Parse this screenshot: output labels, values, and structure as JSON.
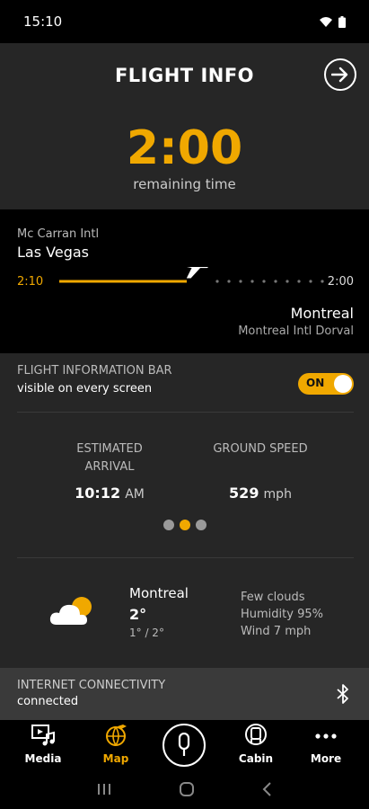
{
  "status_bar": {
    "time": "15:10"
  },
  "header": {
    "title": "FLIGHT INFO",
    "remaining_time": "2:00",
    "remaining_label": "remaining time"
  },
  "route": {
    "origin_airport": "Mc Carran Intl",
    "origin_city": "Las Vegas",
    "elapsed": "2:10",
    "remaining": "2:00",
    "progress": 0.5,
    "destination_city": "Montreal",
    "destination_airport": "Montreal Intl Dorval"
  },
  "info_bar": {
    "title": "FLIGHT INFORMATION BAR",
    "subtitle": "visible on every screen",
    "toggle_label": "ON"
  },
  "stats": {
    "arrival_label_line1": "ESTIMATED",
    "arrival_label_line2": "ARRIVAL",
    "arrival_value": "10:12",
    "arrival_unit": "AM",
    "speed_label": "GROUND SPEED",
    "speed_value": "529",
    "speed_unit": "mph"
  },
  "pager": {
    "count": 3,
    "active_index": 1
  },
  "weather": {
    "city": "Montreal",
    "temp": "2°",
    "range": "1° / 2°",
    "condition": "Few clouds",
    "humidity": "Humidity 95%",
    "wind": "Wind 7 mph"
  },
  "internet": {
    "title": "INTERNET CONNECTIVITY",
    "status": "connected"
  },
  "tabs": {
    "media": "Media",
    "map": "Map",
    "cabin": "Cabin",
    "more": "More"
  },
  "colors": {
    "accent": "#f0a800",
    "panel": "#262626",
    "background": "#000000"
  }
}
